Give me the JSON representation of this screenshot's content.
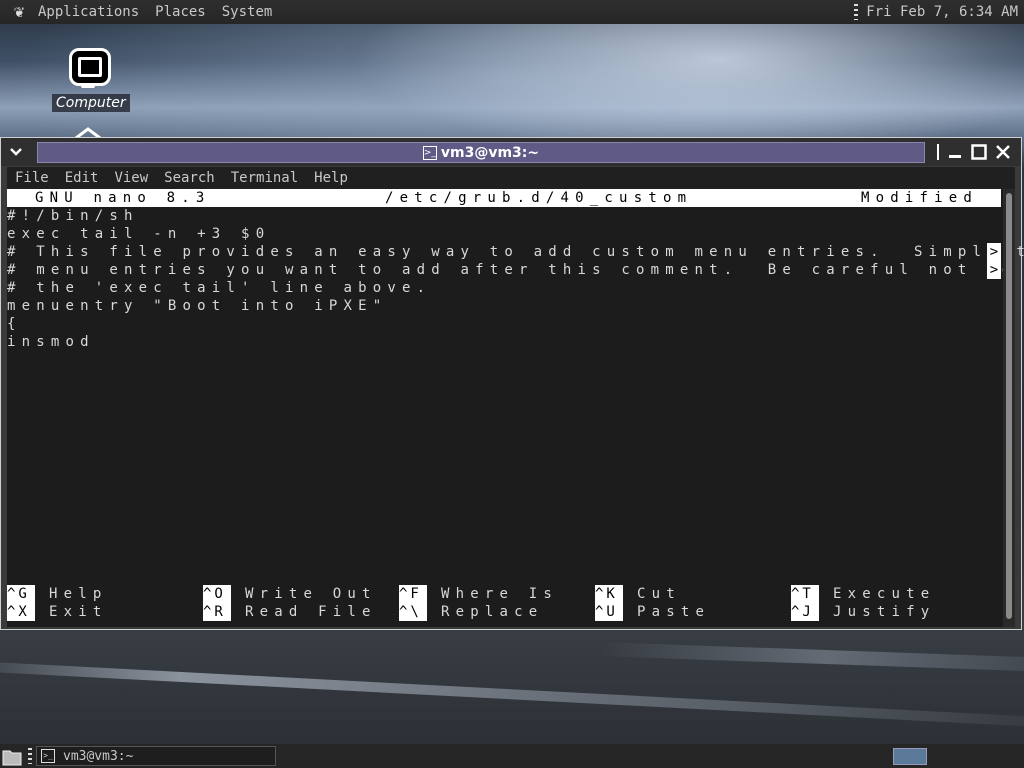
{
  "top_panel": {
    "menus": [
      "Applications",
      "Places",
      "System"
    ],
    "clock": "Fri Feb  7,  6:34 AM"
  },
  "desktop": {
    "icons": [
      {
        "label": "Computer",
        "icon": "computer-icon"
      }
    ]
  },
  "window": {
    "title": "vm3@vm3:~",
    "menu": [
      "File",
      "Edit",
      "View",
      "Search",
      "Terminal",
      "Help"
    ]
  },
  "nano": {
    "version": "GNU nano 8.3",
    "filename": "/etc/grub.d/40_custom",
    "status": "Modified",
    "lines": [
      "#!/bin/sh",
      "exec tail -n +3 $0",
      "# This file provides an easy way to add custom menu entries.  Simply t",
      "# menu entries you want to add after this comment.  Be careful not to",
      "# the 'exec tail' line above.",
      "menuentry \"Boot into iPXE\"",
      "{",
      "insmod"
    ],
    "overflow_marker": ">",
    "shortcuts_row1": [
      {
        "key": "^G",
        "label": "Help"
      },
      {
        "key": "^O",
        "label": "Write Out"
      },
      {
        "key": "^F",
        "label": "Where Is"
      },
      {
        "key": "^K",
        "label": "Cut"
      },
      {
        "key": "^T",
        "label": "Execute"
      }
    ],
    "shortcuts_row2": [
      {
        "key": "^X",
        "label": "Exit"
      },
      {
        "key": "^R",
        "label": "Read File"
      },
      {
        "key": "^\\",
        "label": "Replace"
      },
      {
        "key": "^U",
        "label": "Paste"
      },
      {
        "key": "^J",
        "label": "Justify"
      }
    ]
  },
  "taskbar": {
    "tasks": [
      {
        "label": "vm3@vm3:~"
      }
    ]
  }
}
